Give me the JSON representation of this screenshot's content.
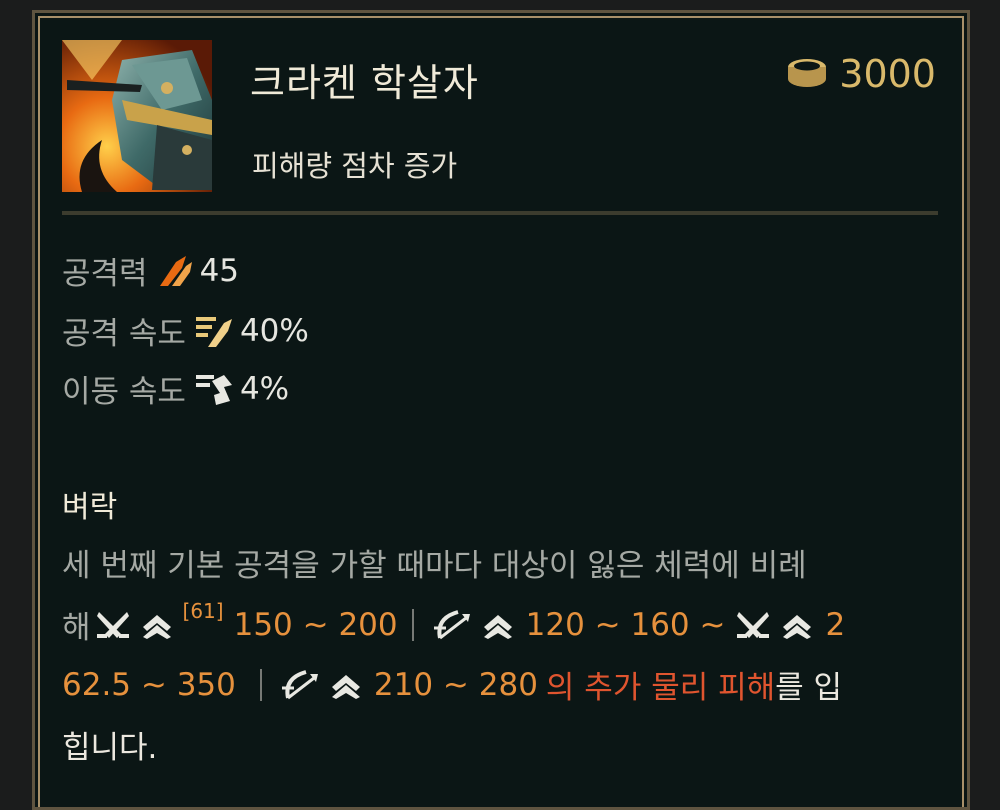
{
  "item": {
    "name": "크라켄 학살자",
    "subtitle": "피해량 점차 증가",
    "price": "3000"
  },
  "stats": [
    {
      "label": "공격력",
      "icon": "attack-damage-icon",
      "value": "45"
    },
    {
      "label": "공격 속도",
      "icon": "attack-speed-icon",
      "value": "40%"
    },
    {
      "label": "이동 속도",
      "icon": "move-speed-icon",
      "value": "4%"
    }
  ],
  "passive": {
    "name": "벼락",
    "line1": "세 번째 기본 공격을 가할 때마다 대상이 잃은 체력에 비례",
    "line2": {
      "prefix": "해",
      "level_tag": "[61]",
      "melee_range_1": "150 ~ 200",
      "ranged_range_1": "120 ~ 160 ~",
      "melee_2_start": "2"
    },
    "line3": {
      "melee_2_end": "62.5 ~ 350",
      "ranged_range_2": "210 ~ 280",
      "damage_text": "의 추가 물리 피해",
      "suffix": "를 입"
    },
    "line4": "힙니다."
  },
  "colors": {
    "gold": "#d9b96b",
    "orange": "#e6913d",
    "red": "#e0552f",
    "frame": "#a8906a",
    "background": "#0b1615"
  }
}
